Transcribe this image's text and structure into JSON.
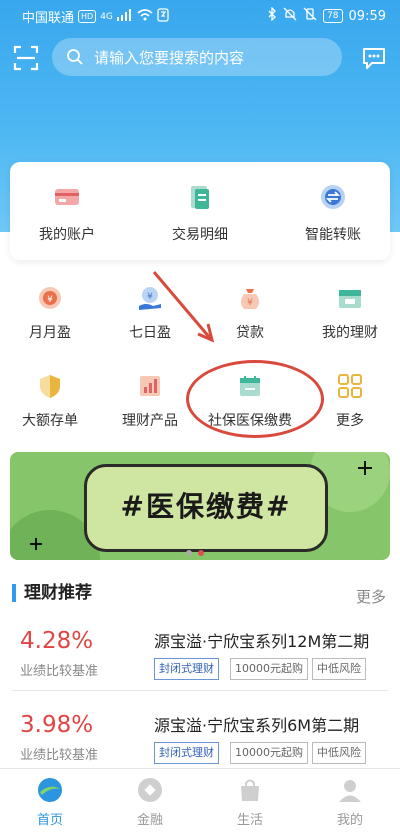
{
  "status_bar": {
    "carrier": "中国联通",
    "hd": "HD",
    "network": "4G",
    "battery": "78",
    "time": "09:59"
  },
  "search": {
    "placeholder": "请输入您要搜索的内容"
  },
  "quick_actions": [
    {
      "label": "我的账户",
      "icon": "card-icon"
    },
    {
      "label": "交易明细",
      "icon": "transaction-icon"
    },
    {
      "label": "智能转账",
      "icon": "transfer-icon"
    }
  ],
  "grid_row1": [
    {
      "label": "月月盈",
      "icon": "monthly-icon"
    },
    {
      "label": "七日盈",
      "icon": "seven-day-icon"
    },
    {
      "label": "贷款",
      "icon": "loan-icon"
    },
    {
      "label": "我的理财",
      "icon": "wealth-icon"
    }
  ],
  "grid_row2": [
    {
      "label": "大额存单",
      "icon": "deposit-icon"
    },
    {
      "label": "理财产品",
      "icon": "product-icon"
    },
    {
      "label": "社保医保缴费",
      "icon": "social-insurance-icon"
    },
    {
      "label": "更多",
      "icon": "more-grid-icon"
    }
  ],
  "banner": {
    "text_hash_left": "#",
    "text": "医保缴费",
    "text_hash_right": "#"
  },
  "section": {
    "title": "理财推荐",
    "more": "更多"
  },
  "products": [
    {
      "rate": "4.28%",
      "rate_desc": "业绩比较基准",
      "name": "源宝溢·宁欣宝系列12M第二期",
      "tags": [
        "封闭式理财",
        "10000元起购",
        "中低风险"
      ]
    },
    {
      "rate": "3.98%",
      "rate_desc": "业绩比较基准",
      "name": "源宝溢·宁欣宝系列6M第二期",
      "tags": [
        "封闭式理财",
        "10000元起购",
        "中低风险"
      ]
    }
  ],
  "tabs": [
    {
      "label": "首页",
      "active": true
    },
    {
      "label": "金融",
      "active": false
    },
    {
      "label": "生活",
      "active": false
    },
    {
      "label": "我的",
      "active": false
    }
  ],
  "colors": {
    "primary": "#2c95e0",
    "rate_red": "#e04545",
    "annotation_red": "#d94a3d"
  }
}
